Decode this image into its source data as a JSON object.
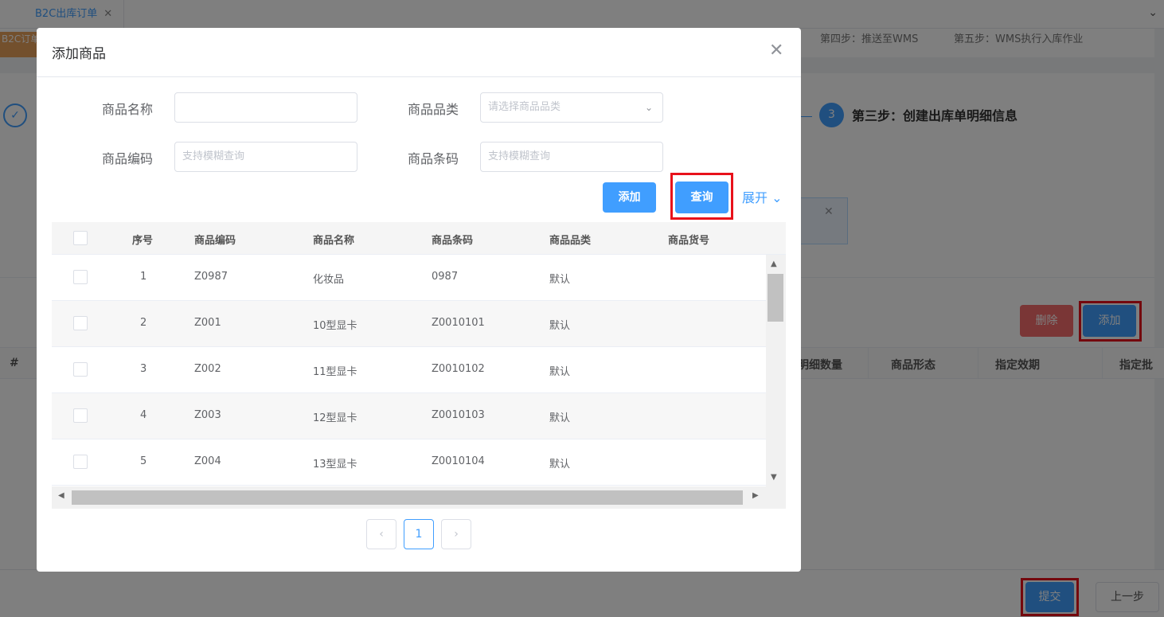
{
  "tab": {
    "label": "B2C出库订单",
    "close": "✕"
  },
  "background": {
    "order_badge": "B2C订单",
    "step4_label": "第四步：推送至WMS",
    "step5_label": "第五步：WMS执行入库作业",
    "step3_num": "3",
    "step3_label": "第三步：创建出库单明细信息",
    "delete_label": "删除",
    "add_label": "添加",
    "table_headers": [
      "#",
      "明细数量",
      "商品形态",
      "指定效期",
      "指定批"
    ],
    "submit_label": "提交",
    "prev_label": "上一步"
  },
  "modal": {
    "title": "添加商品",
    "form": {
      "name_label": "商品名称",
      "name_value": "",
      "category_label": "商品品类",
      "category_placeholder": "请选择商品品类",
      "code_label": "商品编码",
      "code_placeholder": "支持模糊查询",
      "barcode_label": "商品条码",
      "barcode_placeholder": "支持模糊查询"
    },
    "add_label": "添加",
    "query_label": "查询",
    "expand_label": "展开",
    "table": {
      "headers": [
        "序号",
        "商品编码",
        "商品名称",
        "商品条码",
        "商品品类",
        "商品货号"
      ],
      "rows": [
        {
          "idx": "1",
          "code": "Z0987",
          "name": "化妆品",
          "barcode": "0987",
          "category": "默认",
          "sku": ""
        },
        {
          "idx": "2",
          "code": "Z001",
          "name": "10型显卡",
          "barcode": "Z0010101",
          "category": "默认",
          "sku": ""
        },
        {
          "idx": "3",
          "code": "Z002",
          "name": "11型显卡",
          "barcode": "Z0010102",
          "category": "默认",
          "sku": ""
        },
        {
          "idx": "4",
          "code": "Z003",
          "name": "12型显卡",
          "barcode": "Z0010103",
          "category": "默认",
          "sku": ""
        },
        {
          "idx": "5",
          "code": "Z004",
          "name": "13型显卡",
          "barcode": "Z0010104",
          "category": "默认",
          "sku": ""
        }
      ]
    },
    "pagination": {
      "prev": "‹",
      "current": "1",
      "next": "›"
    }
  },
  "colors": {
    "primary": "#409eff",
    "danger": "#f56c6c",
    "highlight": "#e8111b"
  }
}
